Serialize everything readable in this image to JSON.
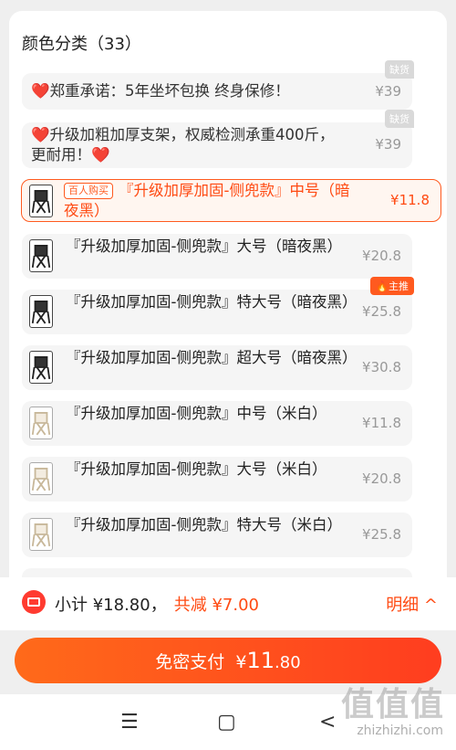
{
  "section_title": "颜色分类（33）",
  "options": [
    {
      "name": "❤️郑重承诺：5年坐坏包换 终身保修！",
      "price": "¥39",
      "tag": "缺货",
      "state": "disabled"
    },
    {
      "name": "❤️升级加粗加厚支架，权威检测承重400斤，更耐用！❤️",
      "price": "¥39",
      "tag": "缺货",
      "state": "disabled"
    },
    {
      "badge": "百人购买",
      "name": "『升级加厚加固-侧兜款』中号（暗夜黑）",
      "price": "¥11.8",
      "state": "selected",
      "thumb": "black"
    },
    {
      "name": "『升级加厚加固-侧兜款』大号（暗夜黑）",
      "price": "¥20.8",
      "thumb": "black"
    },
    {
      "name": "『升级加厚加固-侧兜款』特大号（暗夜黑）",
      "price": "¥25.8",
      "tag": "主推",
      "thumb": "black"
    },
    {
      "name": "『升级加厚加固-侧兜款』超大号（暗夜黑）",
      "price": "¥30.8",
      "thumb": "black"
    },
    {
      "name": "『升级加厚加固-侧兜款』中号（米白）",
      "price": "¥11.8",
      "thumb": "white"
    },
    {
      "name": "『升级加厚加固-侧兜款』大号（米白）",
      "price": "¥20.8",
      "thumb": "white"
    },
    {
      "name": "『升级加厚加固-侧兜款』特大号（米白）",
      "price": "¥25.8",
      "thumb": "white"
    }
  ],
  "summary": {
    "subtotal_label": "小计 ¥18.80，",
    "discount_label": "共减 ¥7.00",
    "detail_label": "明细 ^"
  },
  "pay_button": {
    "prefix": "免密支付",
    "currency": "¥",
    "amount_int": "11",
    "amount_dec": ".80"
  },
  "nav": {
    "menu": "☰",
    "home": "▢",
    "back": "<"
  },
  "watermark": {
    "text": "值值值",
    "url": "zhizhizhi.com"
  },
  "colors": {
    "accent": "#ff4a12",
    "accent_bg": "#fff6f0",
    "muted": "#999999"
  }
}
